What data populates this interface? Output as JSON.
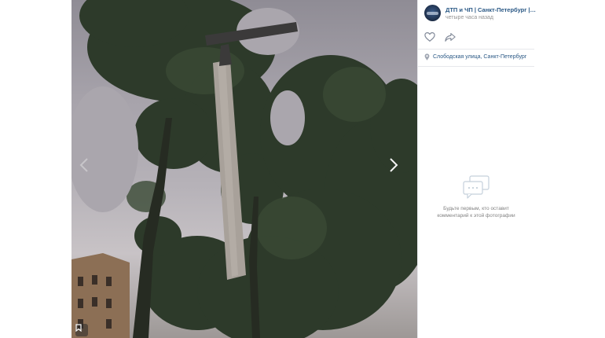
{
  "post": {
    "group_name": "ДТП и ЧП | Санкт-Петербург | П...",
    "time": "четыре часа назад",
    "location": "Слободская улица, Санкт-Петербург"
  },
  "comments": {
    "empty_line1": "Будьте первым, кто оставит",
    "empty_line2": "комментарий к этой фотографии"
  },
  "icons": {
    "like": "heart-icon",
    "share": "share-arrow-icon",
    "location": "location-pin-icon",
    "comments": "comment-bubble-icon",
    "bookmark": "bookmark-icon",
    "next": "chevron-right-icon",
    "prev": "chevron-left-icon"
  },
  "colors": {
    "link": "#2a5885",
    "muted": "#939393",
    "divider": "#e7e8ec"
  }
}
